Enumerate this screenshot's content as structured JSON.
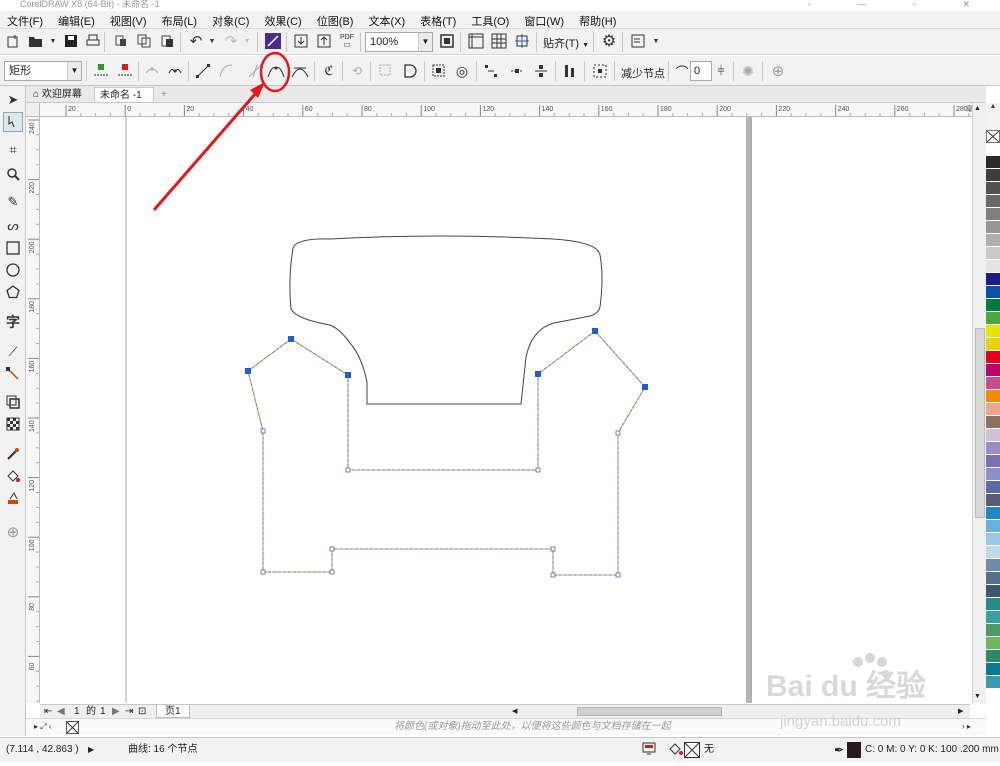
{
  "window": {
    "title": "CorelDRAW X8 (64-Bit) - 未命名 -1"
  },
  "menu": [
    "文件(F)",
    "编辑(E)",
    "视图(V)",
    "布局(L)",
    "对象(C)",
    "效果(C)",
    "位图(B)",
    "文本(X)",
    "表格(T)",
    "工具(O)",
    "窗口(W)",
    "帮助(H)"
  ],
  "toolbar": {
    "zoom_value": "100%",
    "snap_label": "贴齐(T)",
    "pdf_label": "PDF"
  },
  "property_bar": {
    "object_type": "矩形",
    "reduce_nodes_label": "减少节点",
    "smoothness_value": "0"
  },
  "tabs": {
    "welcome": "欢迎屏幕",
    "document": "未命名 -1"
  },
  "ruler": {
    "h_ticks": [
      "20",
      "0",
      "20",
      "40",
      "60",
      "80",
      "100",
      "120",
      "140",
      "160",
      "180",
      "200",
      "220",
      "240",
      "260",
      "280"
    ],
    "h_unit": "毫米",
    "v_ticks": [
      "240",
      "220",
      "200",
      "180",
      "160",
      "140",
      "120",
      "100",
      "80",
      "60"
    ]
  },
  "pagebar": {
    "page_current": "1",
    "page_of": "的",
    "page_total": "1",
    "page_tab": "页1"
  },
  "hint_text": "将颜色(或对象)拖动至此处，以便将这些颜色与文档存储在一起",
  "status": {
    "coords": "(7.114 , 42.863 )",
    "object_info": "曲线: 16 个节点",
    "fill_none": "无",
    "outline_info": "C: 0 M: 0 Y: 0 K: 100  .200 mm"
  },
  "watermark": {
    "brand": "Bai du 经验",
    "url": "jingyan.baidu.com"
  },
  "colors": {
    "annotation": "#e8161b",
    "node": "#1a5fd6",
    "palette": [
      "#ffffff",
      "#2a2a2a",
      "#3e3e3e",
      "#525252",
      "#686868",
      "#7f7f7f",
      "#979797",
      "#b0b0b0",
      "#c9c9c9",
      "#e3e3e3",
      "#1f1a8a",
      "#0a4fa8",
      "#007a3d",
      "#4aa843",
      "#e5e500",
      "#e8d400",
      "#e6001c",
      "#c0006b",
      "#c74f8f",
      "#f08c00",
      "#f2a58c",
      "#8c7060",
      "#cfc2d8",
      "#9a8dc7",
      "#7b6fb5",
      "#8a90c8",
      "#5e6aa8",
      "#5a5a7a",
      "#1f86c8",
      "#6ab0e0",
      "#9cc8e8",
      "#bed8ec",
      "#6e8ca8",
      "#54708c",
      "#3c5670",
      "#2a8a8a",
      "#3aa0a0",
      "#4a9a6a",
      "#6ab85a",
      "#2a8a6a",
      "#0a7a8a",
      "#3a9ab0"
    ]
  }
}
